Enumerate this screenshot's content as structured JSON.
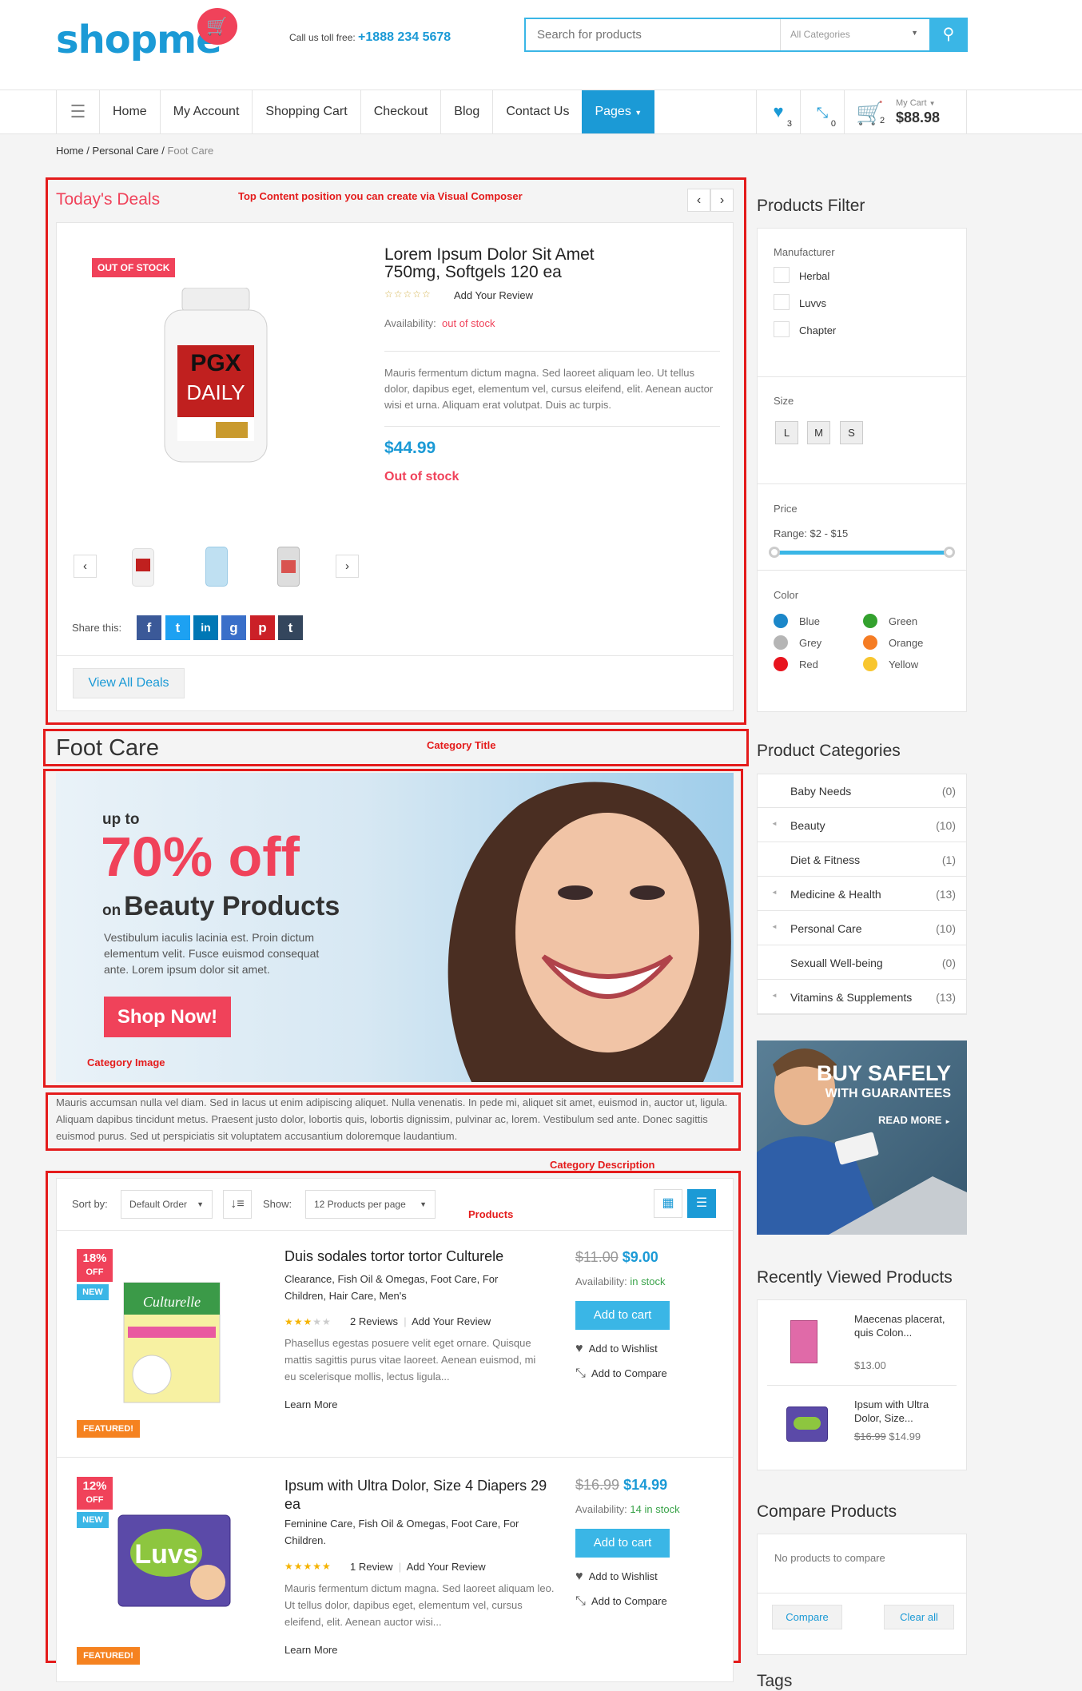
{
  "header": {
    "logo": "shopme",
    "call_label": "Call us toll free:",
    "phone": "+1888 234 5678",
    "search_placeholder": "Search for products",
    "search_category": "All Categories"
  },
  "nav": {
    "items": [
      "Home",
      "My Account",
      "Shopping Cart",
      "Checkout",
      "Blog",
      "Contact Us"
    ],
    "active": "Pages",
    "wishlist_count": "3",
    "compare_count": "0",
    "cart_count": "2",
    "cart_label": "My Cart",
    "cart_total": "$88.98"
  },
  "breadcrumb": {
    "a": "Home",
    "b": "Personal Care",
    "current": "Foot Care"
  },
  "annotations": {
    "top": "Top Content position you can create via Visual Composer",
    "cat_title": "Category Title",
    "cat_image": "Category Image",
    "cat_desc": "Category Description",
    "products": "Products"
  },
  "deals": {
    "title": "Today's Deals",
    "badge": "OUT OF STOCK",
    "product_name": "Lorem Ipsum Dolor Sit Amet 750mg, Softgels 120 ea",
    "review_link": "Add Your Review",
    "availability_label": "Availability:",
    "availability_value": "out of stock",
    "description": "Mauris fermentum dictum magna. Sed laoreet aliquam leo. Ut tellus dolor, dapibus eget, elementum vel, cursus eleifend, elit. Aenean auctor wisi et urna. Aliquam erat volutpat. Duis ac turpis.",
    "price": "$44.99",
    "stock_status": "Out of stock",
    "share_label": "Share this:",
    "view_all": "View All Deals",
    "bottle_brand": "PGX",
    "bottle_text": "DAILY"
  },
  "category": {
    "title": "Foot Care",
    "banner_upto": "up to",
    "banner_percent": "70% off",
    "banner_on": "on",
    "banner_line": "Beauty Products",
    "banner_text": "Vestibulum iaculis lacinia est. Proin dictum elementum velit. Fusce euismod consequat ante. Lorem ipsum dolor sit amet.",
    "banner_button": "Shop Now!",
    "description": "Mauris accumsan nulla vel diam. Sed in lacus ut enim adipiscing aliquet. Nulla venenatis. In pede mi, aliquet sit amet, euismod in, auctor ut, ligula. Aliquam dapibus tincidunt metus. Praesent justo dolor, lobortis quis, lobortis dignissim, pulvinar ac, lorem. Vestibulum sed ante. Donec sagittis euismod purus. Sed ut perspiciatis sit voluptatem accusantium doloremque laudantium."
  },
  "toolbar": {
    "sort_label": "Sort by:",
    "sort_value": "Default Order",
    "show_label": "Show:",
    "show_value": "12 Products per page"
  },
  "products": [
    {
      "discount": "18%",
      "off": "OFF",
      "new": "NEW",
      "featured": "FEATURED!",
      "title": "Duis sodales tortor tortor Culturele",
      "cats": "Clearance, Fish Oil & Omegas, Foot Care, For Children, Hair Care, Men's",
      "rating": 3,
      "reviews": "2 Reviews",
      "add_review": "Add Your Review",
      "text": "Phasellus egestas posuere velit eget ornare. Quisque mattis sagittis purus vitae laoreet. Aenean euismod, mi eu scelerisque mollis, lectus ligula...",
      "learn": "Learn More",
      "old_price": "$11.00",
      "price": "$9.00",
      "avail_label": "Availability:",
      "avail_value": "in stock",
      "cart_btn": "Add to cart",
      "wishlist": "Add to Wishlist",
      "compare": "Add to Compare",
      "box_brand": "Culturelle"
    },
    {
      "discount": "12%",
      "off": "OFF",
      "new": "NEW",
      "featured": "FEATURED!",
      "title": "Ipsum with Ultra Dolor, Size 4 Diapers 29 ea",
      "cats": "Feminine Care, Fish Oil & Omegas, Foot Care, For Children.",
      "rating": 5,
      "reviews": "1 Review",
      "add_review": "Add Your Review",
      "text": "Mauris fermentum dictum magna. Sed laoreet aliquam leo. Ut tellus dolor, dapibus eget, elementum vel, cursus eleifend, elit. Aenean auctor wisi...",
      "learn": "Learn More",
      "old_price": "$16.99",
      "price": "$14.99",
      "avail_label": "Availability:",
      "avail_value": "14 in stock",
      "cart_btn": "Add to cart",
      "wishlist": "Add to Wishlist",
      "compare": "Add to Compare",
      "box_brand": "Luvs"
    }
  ],
  "filter": {
    "title": "Products Filter",
    "manufacturer_label": "Manufacturer",
    "manufacturers": [
      "Herbal",
      "Luvvs",
      "Chapter"
    ],
    "size_label": "Size",
    "sizes": [
      "L",
      "M",
      "S"
    ],
    "price_label": "Price",
    "price_range": "Range: $2 - $15",
    "color_label": "Color",
    "colors": [
      {
        "name": "Blue",
        "hex": "#1b87c9"
      },
      {
        "name": "Green",
        "hex": "#33a12e"
      },
      {
        "name": "Grey",
        "hex": "#b5b5b5"
      },
      {
        "name": "Orange",
        "hex": "#f57c24"
      },
      {
        "name": "Red",
        "hex": "#e8141e"
      },
      {
        "name": "Yellow",
        "hex": "#f8c62f"
      }
    ]
  },
  "categories": {
    "title": "Product Categories",
    "items": [
      {
        "name": "Baby Needs",
        "count": "(0)",
        "has_children": false
      },
      {
        "name": "Beauty",
        "count": "(10)",
        "has_children": true
      },
      {
        "name": "Diet & Fitness",
        "count": "(1)",
        "has_children": false
      },
      {
        "name": "Medicine & Health",
        "count": "(13)",
        "has_children": true
      },
      {
        "name": "Personal Care",
        "count": "(10)",
        "has_children": true
      },
      {
        "name": "Sexuall Well-being",
        "count": "(0)",
        "has_children": false
      },
      {
        "name": "Vitamins & Supplements",
        "count": "(13)",
        "has_children": true
      }
    ]
  },
  "promo": {
    "line1": "BUY SAFELY",
    "line2": "WITH GUARANTEES",
    "link": "READ MORE"
  },
  "recent": {
    "title": "Recently Viewed Products",
    "items": [
      {
        "name": "Maecenas placerat, quis Colon...",
        "price": "$13.00",
        "old": ""
      },
      {
        "name": "Ipsum with Ultra Dolor, Size...",
        "price": "$14.99",
        "old": "$16.99"
      }
    ]
  },
  "compare": {
    "title": "Compare Products",
    "empty": "No products to compare",
    "compare_btn": "Compare",
    "clear_btn": "Clear all"
  },
  "tags": {
    "title": "Tags"
  },
  "colors": {
    "accent": "#1b9ad6",
    "sale": "#f0425a",
    "annotation": "#e41b1b"
  }
}
